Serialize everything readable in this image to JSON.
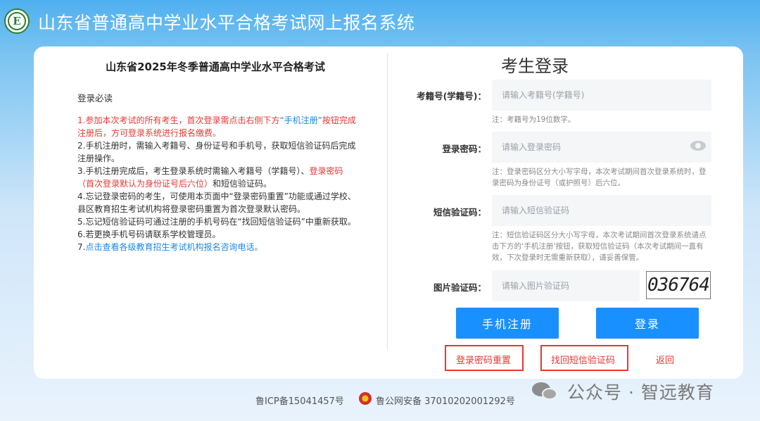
{
  "header": {
    "title": "山东省普通高中学业水平合格考试网上报名系统",
    "logo_letter": "E"
  },
  "notice": {
    "exam_title": "山东省2025年冬季普通高中学业水平合格考试",
    "heading": "登录必读",
    "items": [
      {
        "parts": [
          {
            "text": "1.参加本次考试的所有考生，首次登录需点击右侧下方",
            "style": "red"
          },
          {
            "text": "“手机注册”",
            "style": "blue"
          },
          {
            "text": "按钮完成注册后，方可登录系统进行报名缴费。",
            "style": "red"
          }
        ]
      },
      {
        "parts": [
          {
            "text": "2.手机注册时，需输入考籍号、身份证号和手机号，获取短信验证码后完成注册操作。",
            "style": ""
          }
        ]
      },
      {
        "parts": [
          {
            "text": "3.手机注册完成后，考生登录系统时需输入考籍号（学籍号）、",
            "style": ""
          },
          {
            "text": "登录密码（首次登录默认为身份证号后六位）",
            "style": "red"
          },
          {
            "text": "和短信验证码。",
            "style": ""
          }
        ]
      },
      {
        "parts": [
          {
            "text": "4.忘记登录密码的考生，可使用本页面中“登录密码重置”功能或通过学校、县区教育招生考试机构将登录密码重置为首次登录默认密码。",
            "style": ""
          }
        ]
      },
      {
        "parts": [
          {
            "text": "5.忘记短信验证码可通过注册的手机号码在“找回短信验证码”中重新获取。",
            "style": ""
          }
        ]
      },
      {
        "parts": [
          {
            "text": "6.若更换手机号码请联系学校管理员。",
            "style": ""
          }
        ]
      },
      {
        "parts": [
          {
            "text": "7.",
            "style": ""
          },
          {
            "text": "点击查看各级教育招生考试机构报名咨询电话。",
            "style": "blue"
          }
        ]
      }
    ]
  },
  "login": {
    "title": "考生登录",
    "exam_id_label": "考籍号(学籍号)：",
    "exam_id_placeholder": "请输入考籍号(学籍号)",
    "exam_id_hint": "注：考籍号为19位数字。",
    "password_label": "登录密码：",
    "password_placeholder": "请输入登录密码",
    "password_hint": "注：登录密码区分大小写字母，本次考试期间首次登录系统时，登录密码为身份证号（或护照号）后六位。",
    "sms_label": "短信验证码：",
    "sms_placeholder": "请输入短信验证码",
    "sms_hint": "注：短信验证码区分大小写字母，本次考试期间首次登录系统请点击下方的‘手机注册’按钮，获取短信验证码（本次考试期间一直有效，下次登录时无需重新获取），请妥善保管。",
    "captcha_label": "图片验证码：",
    "captcha_placeholder": "请输入图片验证码",
    "captcha_text": "036764",
    "register_button": "手机注册",
    "login_button": "登录",
    "reset_password_link": "登录密码重置",
    "recover_sms_link": "找回短信验证码",
    "back_link": "返回"
  },
  "footer": {
    "icp": "鲁ICP备15041457号",
    "police": "鲁公网安备 37010202001292号"
  },
  "watermark": {
    "text": "公众号 · 智远教育"
  },
  "colors": {
    "primary": "#1890ff",
    "accent_red": "#e53935",
    "link_blue": "#1e88e5",
    "header_blue": "#4fb0ef"
  }
}
